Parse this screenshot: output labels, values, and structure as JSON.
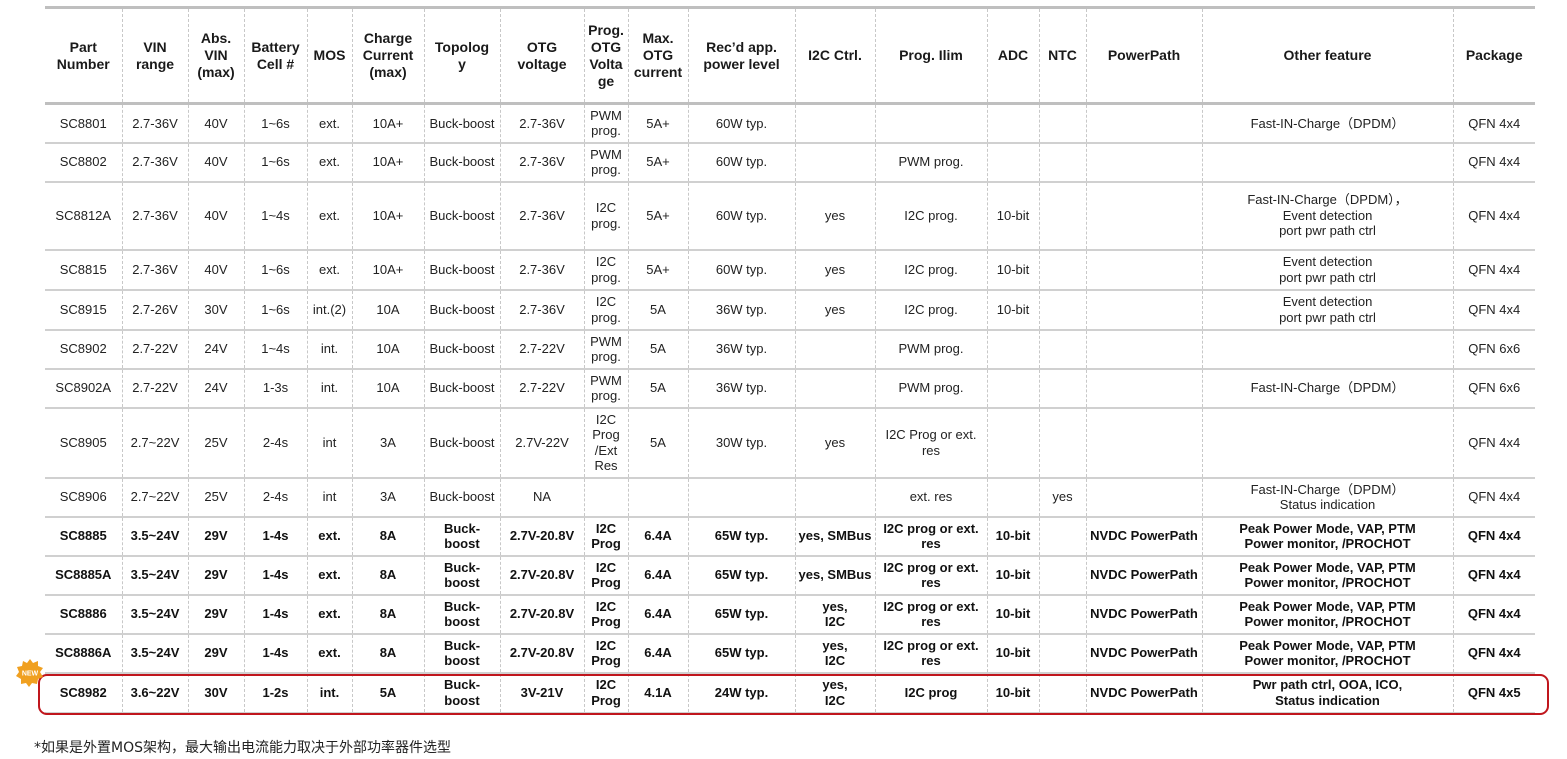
{
  "table": {
    "headers": [
      "Part\nNumber",
      "VIN\nrange",
      "Abs.\nVIN\n(max)",
      "Battery\nCell #",
      "MOS",
      "Charge\nCurrent\n(max)",
      "Topolog\ny",
      "OTG\nvoltage",
      "Prog.\nOTG\nVolta\nge",
      "Max.\nOTG\ncurrent",
      "Rec’d app.\npower level",
      "I2C Ctrl.",
      "Prog. Ilim",
      "ADC",
      "NTC",
      "PowerPath",
      "Other feature",
      "Package"
    ],
    "rows": [
      {
        "bold": false,
        "cells": [
          "SC8801",
          "2.7-36V",
          "40V",
          "1~6s",
          "ext.",
          "10A+",
          "Buck-boost",
          "2.7-36V",
          "PWM\nprog.",
          "5A+",
          "60W typ.",
          "",
          "",
          "",
          "",
          "",
          "Fast-IN-Charge（DPDM）",
          "QFN 4x4"
        ]
      },
      {
        "bold": false,
        "cells": [
          "SC8802",
          "2.7-36V",
          "40V",
          "1~6s",
          "ext.",
          "10A+",
          "Buck-boost",
          "2.7-36V",
          "PWM\nprog.",
          "5A+",
          "60W typ.",
          "",
          "PWM prog.",
          "",
          "",
          "",
          "",
          "QFN 4x4"
        ]
      },
      {
        "bold": false,
        "cells": [
          "SC8812A",
          "2.7-36V",
          "40V",
          "1~4s",
          "ext.",
          "10A+",
          "Buck-boost",
          "2.7-36V",
          "I2C\nprog.",
          "5A+",
          "60W typ.",
          "yes",
          "I2C prog.",
          "10-bit",
          "",
          "",
          "Fast-IN-Charge（DPDM），\nEvent detection\nport pwr path ctrl",
          "QFN 4x4"
        ]
      },
      {
        "bold": false,
        "cells": [
          "SC8815",
          "2.7-36V",
          "40V",
          "1~6s",
          "ext.",
          "10A+",
          "Buck-boost",
          "2.7-36V",
          "I2C\nprog.",
          "5A+",
          "60W typ.",
          "yes",
          "I2C prog.",
          "10-bit",
          "",
          "",
          "Event detection\nport pwr path ctrl",
          "QFN 4x4"
        ]
      },
      {
        "bold": false,
        "cells": [
          "SC8915",
          "2.7-26V",
          "30V",
          "1~6s",
          "int.(2)",
          "10A",
          "Buck-boost",
          "2.7-36V",
          "I2C\nprog.",
          "5A",
          "36W typ.",
          "yes",
          "I2C prog.",
          "10-bit",
          "",
          "",
          "Event detection\nport pwr path ctrl",
          "QFN 4x4"
        ]
      },
      {
        "bold": false,
        "cells": [
          "SC8902",
          "2.7-22V",
          "24V",
          "1~4s",
          "int.",
          "10A",
          "Buck-boost",
          "2.7-22V",
          "PWM\nprog.",
          "5A",
          "36W typ.",
          "",
          "PWM prog.",
          "",
          "",
          "",
          "",
          "QFN 6x6"
        ]
      },
      {
        "bold": false,
        "cells": [
          "SC8902A",
          "2.7-22V",
          "24V",
          "1-3s",
          "int.",
          "10A",
          "Buck-boost",
          "2.7-22V",
          "PWM\nprog.",
          "5A",
          "36W typ.",
          "",
          "PWM prog.",
          "",
          "",
          "",
          "Fast-IN-Charge（DPDM）",
          "QFN 6x6"
        ]
      },
      {
        "bold": false,
        "cells": [
          "SC8905",
          "2.7~22V",
          "25V",
          "2-4s",
          "int",
          "3A",
          "Buck-boost",
          "2.7V-22V",
          "I2C\nProg\n/Ext\nRes",
          "5A",
          "30W typ.",
          "yes",
          "I2C Prog or ext.\nres",
          "",
          "",
          "",
          "",
          "QFN 4x4"
        ]
      },
      {
        "bold": false,
        "cells": [
          "SC8906",
          "2.7~22V",
          "25V",
          "2-4s",
          "int",
          "3A",
          "Buck-boost",
          "NA",
          "",
          "",
          "",
          "",
          "ext. res",
          "",
          "yes",
          "",
          "Fast-IN-Charge（DPDM）\nStatus indication",
          "QFN 4x4"
        ]
      },
      {
        "bold": true,
        "cells": [
          "SC8885",
          "3.5~24V",
          "29V",
          "1-4s",
          "ext.",
          "8A",
          "Buck-\nboost",
          "2.7V-20.8V",
          "I2C\nProg",
          "6.4A",
          "65W typ.",
          "yes, SMBus",
          "I2C prog or ext.\nres",
          "10-bit",
          "",
          "NVDC PowerPath",
          "Peak Power Mode, VAP, PTM\nPower monitor, /PROCHOT",
          "QFN 4x4"
        ]
      },
      {
        "bold": true,
        "cells": [
          "SC8885A",
          "3.5~24V",
          "29V",
          "1-4s",
          "ext.",
          "8A",
          "Buck-\nboost",
          "2.7V-20.8V",
          "I2C\nProg",
          "6.4A",
          "65W typ.",
          "yes, SMBus",
          "I2C prog or ext.\nres",
          "10-bit",
          "",
          "NVDC PowerPath",
          "Peak Power Mode, VAP, PTM\nPower monitor, /PROCHOT",
          "QFN 4x4"
        ]
      },
      {
        "bold": true,
        "cells": [
          "SC8886",
          "3.5~24V",
          "29V",
          "1-4s",
          "ext.",
          "8A",
          "Buck-\nboost",
          "2.7V-20.8V",
          "I2C\nProg",
          "6.4A",
          "65W typ.",
          "yes,\nI2C",
          "I2C prog or ext.\nres",
          "10-bit",
          "",
          "NVDC PowerPath",
          "Peak Power Mode, VAP, PTM\nPower monitor, /PROCHOT",
          "QFN 4x4"
        ]
      },
      {
        "bold": true,
        "cells": [
          "SC8886A",
          "3.5~24V",
          "29V",
          "1-4s",
          "ext.",
          "8A",
          "Buck-\nboost",
          "2.7V-20.8V",
          "I2C\nProg",
          "6.4A",
          "65W typ.",
          "yes,\nI2C",
          "I2C prog or ext.\nres",
          "10-bit",
          "",
          "NVDC PowerPath",
          "Peak Power Mode, VAP, PTM\nPower monitor, /PROCHOT",
          "QFN 4x4"
        ]
      },
      {
        "bold": true,
        "cells": [
          "SC8982",
          "3.6~22V",
          "30V",
          "1-2s",
          "int.",
          "5A",
          "Buck-\nboost",
          "3V-21V",
          "I2C\nProg",
          "4.1A",
          "24W typ.",
          "yes,\nI2C",
          "I2C prog",
          "10-bit",
          "",
          "NVDC PowerPath",
          "Pwr path ctrl,  OOA, ICO,\nStatus indication",
          "QFN 4x5"
        ]
      }
    ],
    "row_heights": [
      39,
      39,
      68,
      40,
      40,
      39,
      39,
      70,
      39,
      39,
      39,
      39,
      39,
      40
    ]
  },
  "badge": {
    "text": "NEW",
    "color": "#f0a020"
  },
  "highlight": {
    "color": "#c0161d"
  },
  "footnote": "*如果是外置MOS架构，最大输出电流能力取决于外部功率器件选型"
}
